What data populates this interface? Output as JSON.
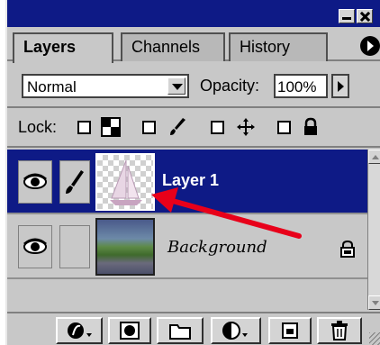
{
  "tabs": [
    {
      "label": "Layers",
      "active": true
    },
    {
      "label": "Channels",
      "active": false
    },
    {
      "label": "History",
      "active": false
    }
  ],
  "blend_mode": {
    "value": "Normal"
  },
  "opacity": {
    "label": "Opacity:",
    "value": "100%"
  },
  "lock": {
    "label": "Lock:",
    "options": [
      "lock-transparency-icon",
      "lock-image-icon",
      "lock-position-icon",
      "lock-all-icon"
    ]
  },
  "layers": [
    {
      "name": "Layer 1",
      "selected": true,
      "visible": true,
      "link_icon": "brush-icon"
    },
    {
      "name": "Background",
      "selected": false,
      "visible": true,
      "locked": true
    }
  ],
  "toolbar": [
    "add-style-icon",
    "add-mask-icon",
    "new-set-icon",
    "adjustment-layer-icon",
    "new-layer-icon",
    "trash-icon"
  ],
  "colors": {
    "selection": "#0e1a86",
    "panel": "#c8c8c8",
    "annotation_arrow": "#e8001a"
  }
}
